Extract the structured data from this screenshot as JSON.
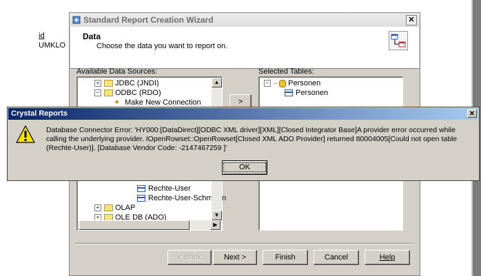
{
  "background": {
    "field_label": "id",
    "field_value": "UMKLO"
  },
  "wizard": {
    "title": "Standard Report Creation Wizard",
    "close": "✕",
    "header_title": "Data",
    "header_subtitle": "Choose the data you want to report on.",
    "available_label": "Available Data Sources:",
    "selected_label": "Selected Tables:",
    "add_button": ">",
    "available_tree": [
      {
        "kind": "folder",
        "exp": "+",
        "label": "JDBC (JNDI)"
      },
      {
        "kind": "folder",
        "exp": "−",
        "label": "ODBC (RDO)"
      },
      {
        "kind": "wand",
        "label": "Make New Connection"
      },
      {
        "kind": "table",
        "label": "Rechte-User"
      },
      {
        "kind": "table",
        "label": "Rechte-User-Schmollin"
      },
      {
        "kind": "folder",
        "exp": "+",
        "label": "OLAP"
      },
      {
        "kind": "folder",
        "exp": "+",
        "label": "OLE DB (ADO)"
      }
    ],
    "selected_tree": [
      {
        "kind": "db",
        "exp": "−",
        "label": "Personen"
      },
      {
        "kind": "table",
        "label": "Personen"
      }
    ],
    "buttons": {
      "back": "< Back",
      "next": "Next >",
      "finish": "Finish",
      "cancel": "Cancel",
      "help": "Help"
    }
  },
  "dialog": {
    "title": "Crystal Reports",
    "close": "✕",
    "message": "Database Connector Error: 'HY000:[DataDirect][ODBC XML driver][XML][Closed Integrator Base]A provider error occurred while calling the underlying provider.  IOpenRowset::OpenRowset[Closed XML ADO Provider] returned 80004005[Could not open table (Rechte-User)]. [Database Vendor Code: -2147467259 ]'",
    "ok": "OK"
  }
}
